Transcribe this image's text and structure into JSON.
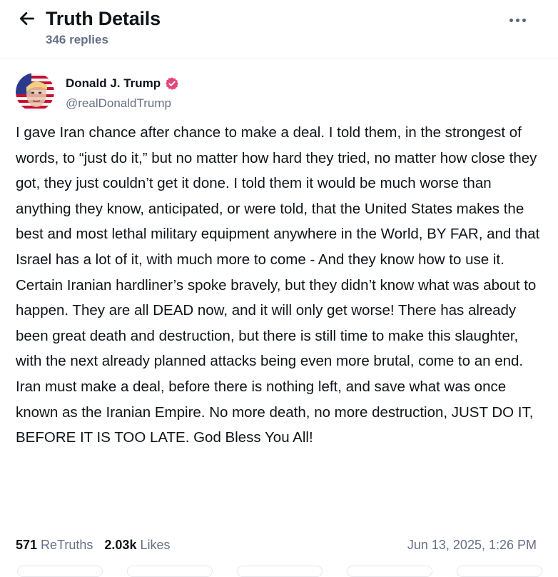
{
  "header": {
    "title": "Truth Details",
    "replies": "346 replies"
  },
  "post": {
    "author_name": "Donald J. Trump",
    "handle": "@realDonaldTrump",
    "text": "I gave Iran chance after chance to make a deal. I told them, in the strongest of words, to “just do it,” but no matter how hard they tried, no matter how close they got, they just couldn’t get it done. I told them it would be much worse than anything they know, anticipated, or were told, that the United States makes the best and most lethal military equipment anywhere in the World, BY FAR, and that Israel has a lot of it, with much more to come - And they know how to use it. Certain Iranian hardliner’s spoke bravely, but they didn’t know what was about to happen. They are all DEAD now, and it will only get worse! There has already been great death and destruction, but there is still time to make this slaughter, with the next already planned attacks being even more brutal, come to an end. Iran must make a deal, before there is nothing left, and save what was once known as the Iranian Empire. No more death, no more destruction, JUST DO IT, BEFORE IT IS TOO LATE. God Bless You All!",
    "retruths_count": "571",
    "retruths_label": "ReTruths",
    "likes_count": "2.03k",
    "likes_label": "Likes",
    "timestamp": "Jun 13, 2025, 1:26 PM"
  },
  "icons": {
    "back": "arrow-left-icon",
    "more": "more-horizontal-icon",
    "verified": "verified-badge-icon"
  },
  "colors": {
    "text": "#0f1419",
    "muted": "#667085",
    "verified": "#e5467a"
  }
}
